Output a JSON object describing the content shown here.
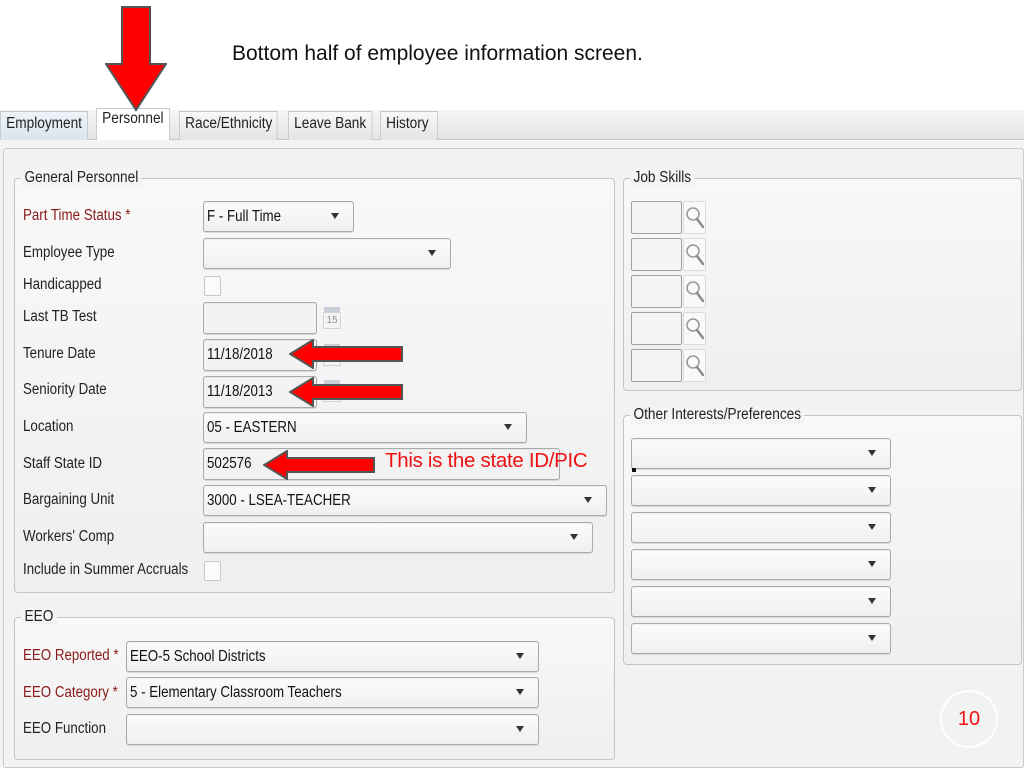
{
  "slide": {
    "title": "Bottom half of employee information screen.",
    "annotation": "This is the state ID/PIC",
    "page_number": "10",
    "accent_color": "#ee1111"
  },
  "tabs": [
    {
      "label": "Employment",
      "active": false
    },
    {
      "label": "Personnel",
      "active": true
    },
    {
      "label": "Race/Ethnicity",
      "active": false
    },
    {
      "label": "Leave Bank",
      "active": false
    },
    {
      "label": "History",
      "active": false
    }
  ],
  "general_personnel": {
    "legend": "General Personnel",
    "fields": {
      "part_time_status": {
        "label": "Part Time Status *",
        "value": "F - Full Time",
        "required": true
      },
      "employee_type": {
        "label": "Employee Type",
        "value": ""
      },
      "handicapped": {
        "label": "Handicapped",
        "checked": false
      },
      "last_tb_test": {
        "label": "Last TB Test",
        "value": ""
      },
      "tenure_date": {
        "label": "Tenure Date",
        "value": "11/18/2018"
      },
      "seniority_date": {
        "label": "Seniority Date",
        "value": "11/18/2013"
      },
      "location": {
        "label": "Location",
        "value": "05 - EASTERN"
      },
      "staff_state_id": {
        "label": "Staff State ID",
        "value": "502576"
      },
      "bargaining_unit": {
        "label": "Bargaining Unit",
        "value": "3000 - LSEA-TEACHER"
      },
      "workers_comp": {
        "label": "Workers' Comp",
        "value": ""
      },
      "summer_accruals": {
        "label": "Include in Summer Accruals",
        "checked": false
      }
    },
    "calendar_icon_text": "15"
  },
  "eeo": {
    "legend": "EEO",
    "fields": {
      "reported": {
        "label": "EEO Reported *",
        "value": "EEO-5 School Districts",
        "required": true
      },
      "category": {
        "label": "EEO Category *",
        "value": "5 - Elementary Classroom Teachers",
        "required": true
      },
      "function": {
        "label": "EEO Function",
        "value": ""
      }
    }
  },
  "job_skills": {
    "legend": "Job Skills",
    "items": [
      {
        "value": ""
      },
      {
        "value": ""
      },
      {
        "value": ""
      },
      {
        "value": ""
      },
      {
        "value": ""
      }
    ]
  },
  "other_interests": {
    "legend": "Other Interests/Preferences",
    "items": [
      {
        "value": ""
      },
      {
        "value": ""
      },
      {
        "value": ""
      },
      {
        "value": ""
      },
      {
        "value": ""
      },
      {
        "value": ""
      }
    ]
  }
}
